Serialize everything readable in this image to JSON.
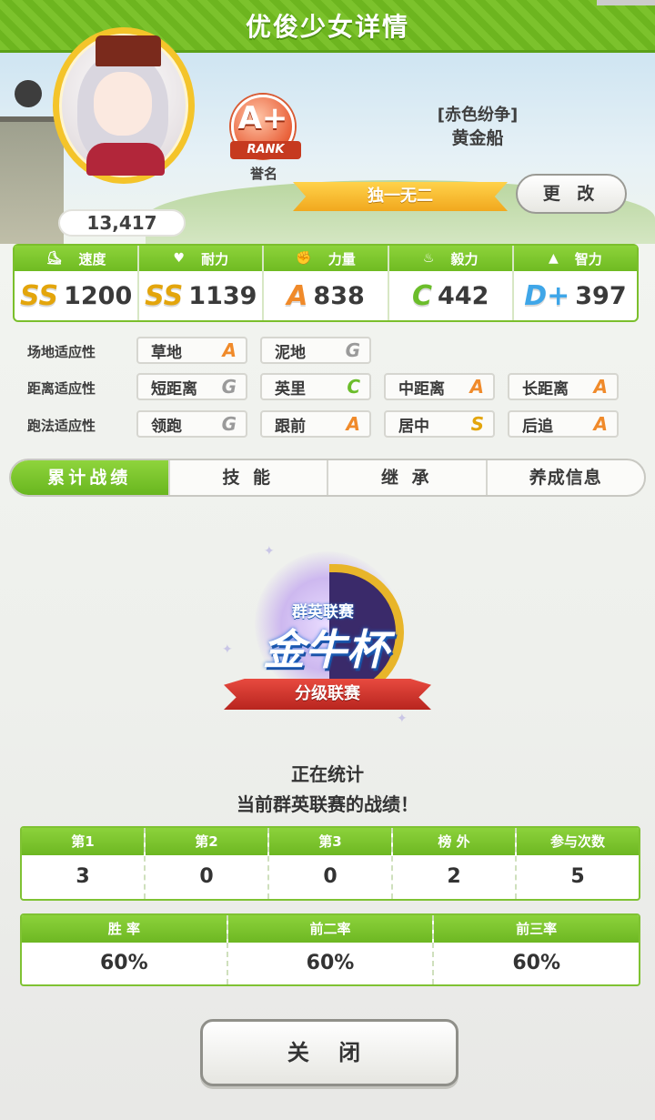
{
  "header": {
    "title": "优俊少女详情"
  },
  "profile": {
    "score": "13,417",
    "rank_grade": "A+",
    "rank_word": "RANK",
    "rank_label": "誉名",
    "epithet": "[赤色纷争]",
    "name": "黄金船",
    "title_banner": "独一无二",
    "change_label": "更 改"
  },
  "stats": [
    {
      "label": "速度",
      "icon": "shoe-icon",
      "icon_glyph": "⛸",
      "grade": "SS",
      "grade_color": "#e3a50c",
      "value": "1200"
    },
    {
      "label": "耐力",
      "icon": "heart-icon",
      "icon_glyph": "♥",
      "grade": "SS",
      "grade_color": "#e3a50c",
      "value": "1139"
    },
    {
      "label": "力量",
      "icon": "muscle-icon",
      "icon_glyph": "✊",
      "grade": "A",
      "grade_color": "#f08a2a",
      "value": "838"
    },
    {
      "label": "毅力",
      "icon": "flame-icon",
      "icon_glyph": "♨",
      "grade": "C",
      "grade_color": "#6bbd2a",
      "value": "442"
    },
    {
      "label": "智力",
      "icon": "graduation-cap-icon",
      "icon_glyph": "▲",
      "grade": "D+",
      "grade_color": "#3fa6e8",
      "value": "397"
    }
  ],
  "aptitude": {
    "track": {
      "label": "场地适应性",
      "items": [
        {
          "name": "草地",
          "grade": "A"
        },
        {
          "name": "泥地",
          "grade": "G"
        }
      ]
    },
    "distance": {
      "label": "距离适应性",
      "items": [
        {
          "name": "短距离",
          "grade": "G"
        },
        {
          "name": "英里",
          "grade": "C"
        },
        {
          "name": "中距离",
          "grade": "A"
        },
        {
          "name": "长距离",
          "grade": "A"
        }
      ]
    },
    "style": {
      "label": "跑法适应性",
      "items": [
        {
          "name": "领跑",
          "grade": "G"
        },
        {
          "name": "跟前",
          "grade": "A"
        },
        {
          "name": "居中",
          "grade": "S"
        },
        {
          "name": "后追",
          "grade": "A"
        }
      ]
    }
  },
  "tabs": [
    {
      "label": "累计战绩",
      "active": true
    },
    {
      "label": "技 能",
      "active": false
    },
    {
      "label": "继 承",
      "active": false
    },
    {
      "label": "养成信息",
      "active": false
    }
  ],
  "emblem": {
    "top": "群英联赛",
    "main": "金牛杯",
    "ribbon": "分级联赛"
  },
  "status": {
    "line1": "正在统计",
    "line2": "当前群英联赛的战绩！"
  },
  "results": {
    "placings": [
      {
        "label": "第1",
        "value": "3"
      },
      {
        "label": "第2",
        "value": "0"
      },
      {
        "label": "第3",
        "value": "0"
      },
      {
        "label": "榜 外",
        "value": "2"
      },
      {
        "label": "参与次数",
        "value": "5"
      }
    ],
    "rates": [
      {
        "label": "胜 率",
        "value": "60%"
      },
      {
        "label": "前二率",
        "value": "60%"
      },
      {
        "label": "前三率",
        "value": "60%"
      }
    ]
  },
  "footer": {
    "close_label": "关 闭"
  },
  "colors": {
    "accent_green": "#7cc22c",
    "gold": "#f4c42a",
    "rank_orange": "#e9613a"
  }
}
